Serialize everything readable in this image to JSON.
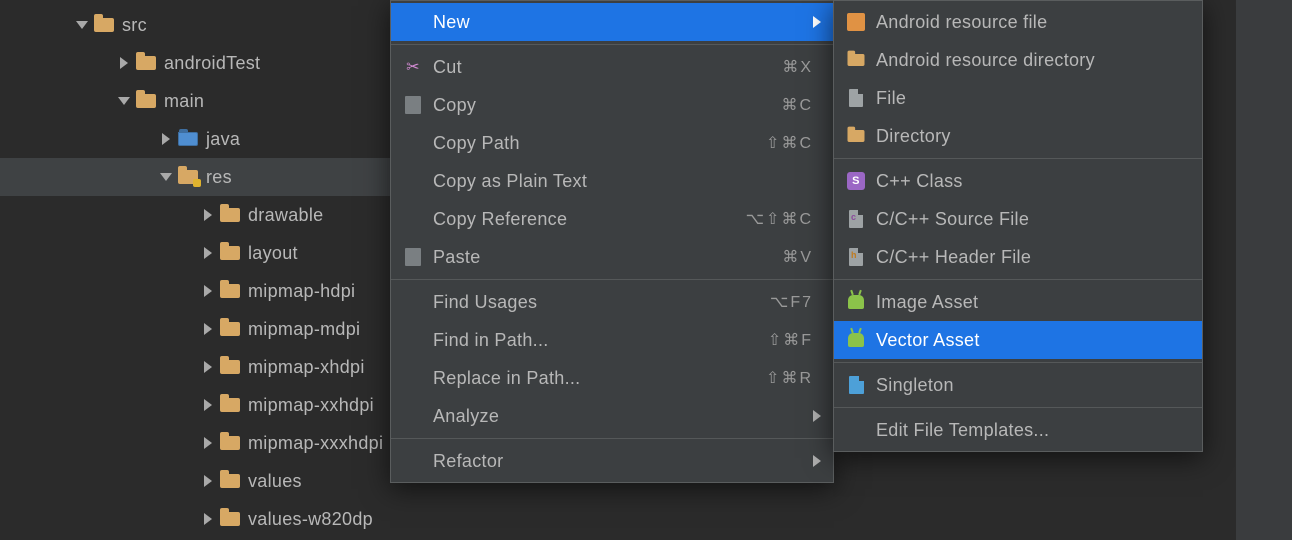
{
  "tree": [
    {
      "label": "src",
      "depth": 0,
      "arrow": "down",
      "folder": "tan",
      "sel": false
    },
    {
      "label": "androidTest",
      "depth": 1,
      "arrow": "right",
      "folder": "tan",
      "sel": false
    },
    {
      "label": "main",
      "depth": 1,
      "arrow": "down",
      "folder": "tan",
      "sel": false
    },
    {
      "label": "java",
      "depth": 2,
      "arrow": "right",
      "folder": "blue",
      "sel": false
    },
    {
      "label": "res",
      "depth": 2,
      "arrow": "down",
      "folder": "res",
      "sel": true
    },
    {
      "label": "drawable",
      "depth": 3,
      "arrow": "right",
      "folder": "tansm",
      "sel": false
    },
    {
      "label": "layout",
      "depth": 3,
      "arrow": "right",
      "folder": "tansm",
      "sel": false
    },
    {
      "label": "mipmap-hdpi",
      "depth": 3,
      "arrow": "right",
      "folder": "tansm",
      "sel": false
    },
    {
      "label": "mipmap-mdpi",
      "depth": 3,
      "arrow": "right",
      "folder": "tansm",
      "sel": false
    },
    {
      "label": "mipmap-xhdpi",
      "depth": 3,
      "arrow": "right",
      "folder": "tansm",
      "sel": false
    },
    {
      "label": "mipmap-xxhdpi",
      "depth": 3,
      "arrow": "right",
      "folder": "tansm",
      "sel": false
    },
    {
      "label": "mipmap-xxxhdpi",
      "depth": 3,
      "arrow": "right",
      "folder": "tansm",
      "sel": false
    },
    {
      "label": "values",
      "depth": 3,
      "arrow": "right",
      "folder": "tansm",
      "sel": false
    },
    {
      "label": "values-w820dp",
      "depth": 3,
      "arrow": "right",
      "folder": "tansm",
      "sel": false
    }
  ],
  "ctx": [
    {
      "kind": "item",
      "label": "New",
      "icon": "",
      "shortcut": "",
      "submenu": true,
      "hl": true
    },
    {
      "kind": "sep"
    },
    {
      "kind": "item",
      "label": "Cut",
      "icon": "cut",
      "shortcut": "⌘X",
      "submenu": false,
      "hl": false
    },
    {
      "kind": "item",
      "label": "Copy",
      "icon": "copy",
      "shortcut": "⌘C",
      "submenu": false,
      "hl": false
    },
    {
      "kind": "item",
      "label": "Copy Path",
      "icon": "",
      "shortcut": "⇧⌘C",
      "submenu": false,
      "hl": false
    },
    {
      "kind": "item",
      "label": "Copy as Plain Text",
      "icon": "",
      "shortcut": "",
      "submenu": false,
      "hl": false
    },
    {
      "kind": "item",
      "label": "Copy Reference",
      "icon": "",
      "shortcut": "⌥⇧⌘C",
      "submenu": false,
      "hl": false
    },
    {
      "kind": "item",
      "label": "Paste",
      "icon": "paste",
      "shortcut": "⌘V",
      "submenu": false,
      "hl": false
    },
    {
      "kind": "sep"
    },
    {
      "kind": "item",
      "label": "Find Usages",
      "icon": "",
      "shortcut": "⌥F7",
      "submenu": false,
      "hl": false
    },
    {
      "kind": "item",
      "label": "Find in Path...",
      "icon": "",
      "shortcut": "⇧⌘F",
      "submenu": false,
      "hl": false
    },
    {
      "kind": "item",
      "label": "Replace in Path...",
      "icon": "",
      "shortcut": "⇧⌘R",
      "submenu": false,
      "hl": false
    },
    {
      "kind": "item",
      "label": "Analyze",
      "icon": "",
      "shortcut": "",
      "submenu": true,
      "hl": false
    },
    {
      "kind": "sep"
    },
    {
      "kind": "item",
      "label": "Refactor",
      "icon": "",
      "shortcut": "",
      "submenu": true,
      "hl": false
    }
  ],
  "sub": [
    {
      "kind": "item",
      "label": "Android resource file",
      "icon": "orange",
      "hl": false
    },
    {
      "kind": "item",
      "label": "Android resource directory",
      "icon": "folder",
      "hl": false
    },
    {
      "kind": "item",
      "label": "File",
      "icon": "file",
      "hl": false
    },
    {
      "kind": "item",
      "label": "Directory",
      "icon": "folder",
      "hl": false
    },
    {
      "kind": "sep"
    },
    {
      "kind": "item",
      "label": "C++ Class",
      "icon": "purpleS",
      "hl": false
    },
    {
      "kind": "item",
      "label": "C/C++ Source File",
      "icon": "cppfile",
      "hl": false
    },
    {
      "kind": "item",
      "label": "C/C++ Header File",
      "icon": "hdrfile",
      "hl": false
    },
    {
      "kind": "sep"
    },
    {
      "kind": "item",
      "label": "Image Asset",
      "icon": "android",
      "hl": false
    },
    {
      "kind": "item",
      "label": "Vector Asset",
      "icon": "android",
      "hl": true
    },
    {
      "kind": "sep"
    },
    {
      "kind": "item",
      "label": "Singleton",
      "icon": "bluefile",
      "hl": false
    },
    {
      "kind": "sep"
    },
    {
      "kind": "item",
      "label": "Edit File Templates...",
      "icon": "",
      "hl": false
    }
  ]
}
